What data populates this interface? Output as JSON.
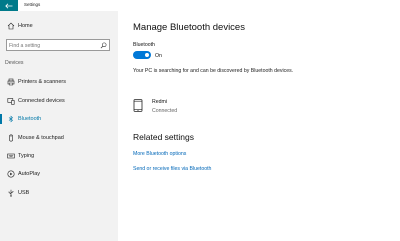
{
  "app": {
    "title": "Settings"
  },
  "sidebar": {
    "home_label": "Home",
    "search_placeholder": "Find a setting",
    "section_label": "Devices",
    "items": [
      {
        "label": "Printers & scanners",
        "icon": "printer-icon"
      },
      {
        "label": "Connected devices",
        "icon": "connected-devices-icon"
      },
      {
        "label": "Bluetooth",
        "icon": "bluetooth-icon",
        "active": true
      },
      {
        "label": "Mouse & touchpad",
        "icon": "mouse-icon"
      },
      {
        "label": "Typing",
        "icon": "keyboard-icon"
      },
      {
        "label": "AutoPlay",
        "icon": "autoplay-icon"
      },
      {
        "label": "USB",
        "icon": "usb-icon"
      }
    ]
  },
  "main": {
    "title": "Manage Bluetooth devices",
    "bluetooth_label": "Bluetooth",
    "toggle_state": "On",
    "description": "Your PC is searching for and can be discovered by Bluetooth devices.",
    "device": {
      "name": "Redmi",
      "status": "Connected",
      "icon": "phone-icon"
    },
    "related_title": "Related settings",
    "links": [
      "More Bluetooth options",
      "Send or receive files via Bluetooth"
    ]
  },
  "colors": {
    "accent": "#0078d7",
    "back_button": "#007a8a",
    "sidebar_bg": "#f2f2f2",
    "link": "#0067b8"
  }
}
